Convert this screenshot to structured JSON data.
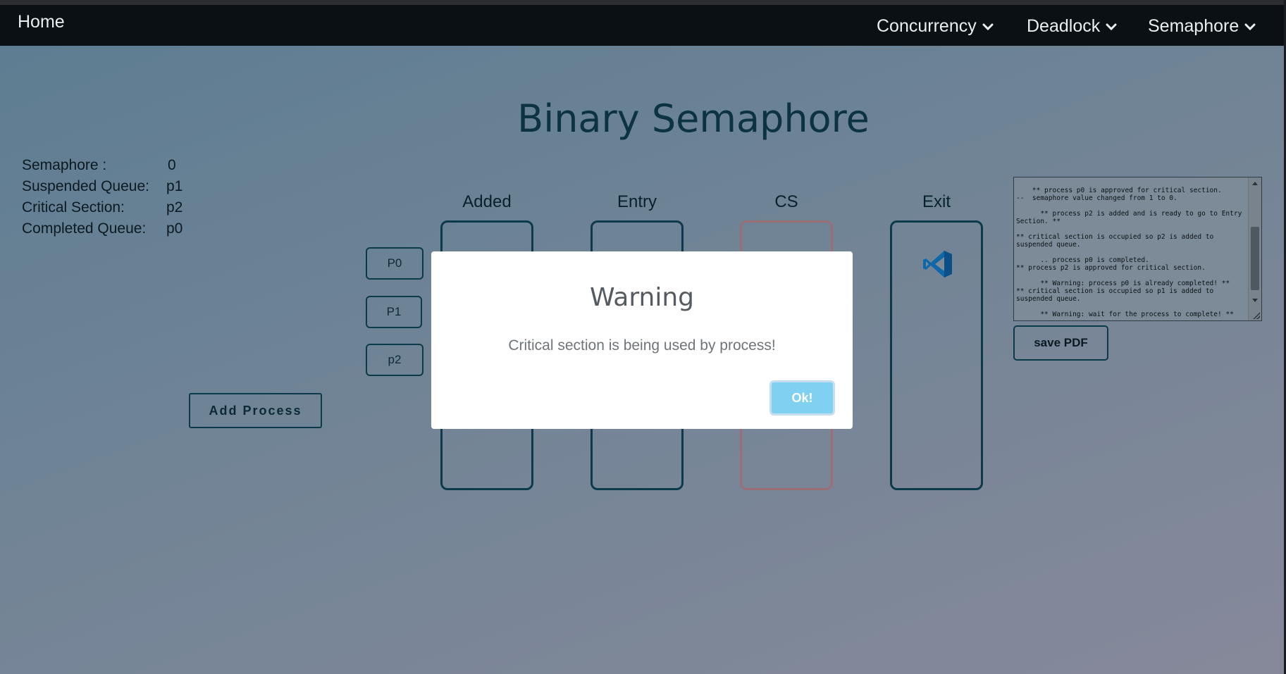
{
  "navbar": {
    "home": "Home",
    "items": [
      {
        "label": "Concurrency",
        "icon": "chevron-down-icon"
      },
      {
        "label": "Deadlock",
        "icon": "chevron-down-icon"
      },
      {
        "label": "Semaphore",
        "icon": "chevron-down-icon"
      }
    ]
  },
  "page": {
    "title": "Binary Semaphore"
  },
  "stats": [
    {
      "label": "Semaphore :",
      "value": "0"
    },
    {
      "label": "Suspended Queue:",
      "value": "p1"
    },
    {
      "label": "Critical Section:",
      "value": "p2"
    },
    {
      "label": "Completed Queue:",
      "value": "p0"
    }
  ],
  "processes": [
    "P0",
    "P1",
    "p2"
  ],
  "add_process_label": "Add Process",
  "columns": {
    "added": "Added",
    "entry": "Entry",
    "cs": "CS",
    "exit": "Exit"
  },
  "exit_icon": "vscode-icon",
  "log": {
    "text": "** process p0 is approved for critical section.\n--  semaphore value changed from 1 to 0.\n\n      ** process p2 is added and is ready to go to Entry Section. **\n\n** critical section is occupied so p2 is added to suspended queue.\n\n      .. process p0 is completed.\n** process p2 is approved for critical section.\n\n      ** Warning: process p0 is already completed! **\n** critical section is occupied so p1 is added to suspended queue.\n\n      ** Warning: wait for the process to complete! **"
  },
  "save_pdf_label": "save PDF",
  "modal": {
    "title": "Warning",
    "message": "Critical section is being used by process!",
    "ok_label": "Ok!"
  },
  "colors": {
    "navbar_bg": "#0b1014",
    "border_dark": "#0b3b4a",
    "cs_border": "#9a6e74",
    "ok_button": "#7fd0f1"
  }
}
